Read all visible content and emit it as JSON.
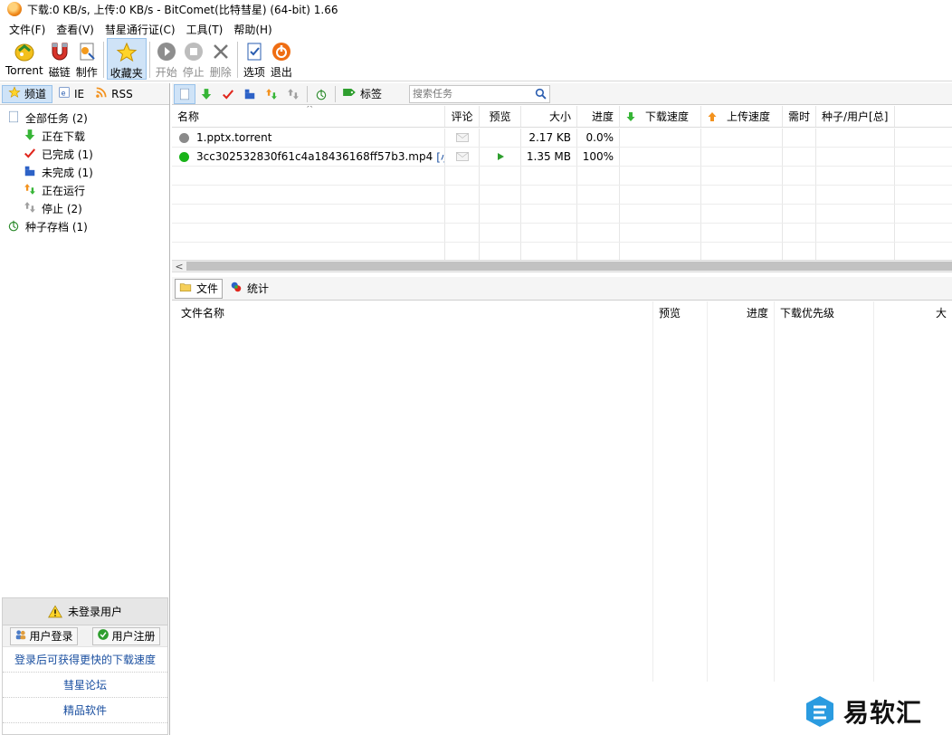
{
  "window": {
    "title": "下载:0 KB/s, 上传:0 KB/s - BitComet(比特彗星) (64-bit) 1.66"
  },
  "menu": [
    "文件(F)",
    "查看(V)",
    "彗星通行证(C)",
    "工具(T)",
    "帮助(H)"
  ],
  "toolbar": {
    "torrent": "Torrent",
    "magnet": "磁链",
    "make": "制作",
    "favorites": "收藏夹",
    "start": "开始",
    "stop": "停止",
    "delete": "删除",
    "options": "选项",
    "exit": "退出"
  },
  "left_tabs": [
    "频道",
    "IE",
    "RSS"
  ],
  "tree": {
    "all": "全部任务 (2)",
    "downloading": "正在下载",
    "completed": "已完成 (1)",
    "incomplete": "未完成 (1)",
    "running": "正在运行",
    "stopped": "停止 (2)",
    "archive": "种子存档 (1)"
  },
  "user_panel": {
    "status": "未登录用户",
    "login": "用户登录",
    "register": "用户注册",
    "promo1": "登录后可获得更快的下载速度",
    "promo2": "彗星论坛",
    "promo3": "精品软件"
  },
  "task_toolbar": {
    "tag_label": "标签",
    "search_placeholder": "搜索任务"
  },
  "task_table": {
    "columns": [
      "名称",
      "评论",
      "预览",
      "大小",
      "进度",
      "下载速度",
      "上传速度",
      "需时",
      "种子/用户[总]"
    ],
    "rows": [
      {
        "name": "1.pptx.torrent",
        "size": "2.17 KB",
        "progress": "0.0%",
        "status_color": "#8a8a8a",
        "extra": ""
      },
      {
        "name": "3cc302532830f61c4a18436168ff57b3.mp4",
        "size": "1.35 MB",
        "progress": "100%",
        "status_color": "#19b319",
        "extra": "[小..."
      }
    ]
  },
  "bottom_tabs": [
    "文件",
    "统计"
  ],
  "file_table": {
    "columns": [
      "文件名称",
      "预览",
      "进度",
      "下载优先级",
      "大"
    ]
  },
  "watermark": {
    "text": "易软汇"
  },
  "colors": {
    "selected_bg": "#cfe3f7",
    "link": "#1a4fa0"
  }
}
